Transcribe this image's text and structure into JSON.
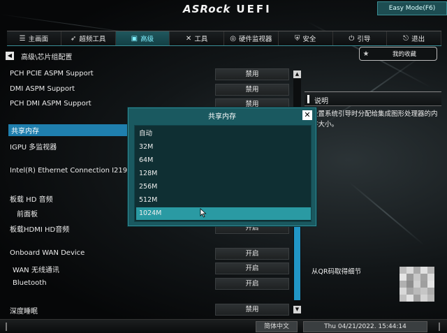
{
  "header": {
    "logo": "ASRock",
    "product": "UEFI",
    "easy_mode_label": "Easy Mode(F6)"
  },
  "tabs": [
    {
      "label": "主画面",
      "icon": "list-icon"
    },
    {
      "label": "超频工具",
      "icon": "rocket-icon"
    },
    {
      "label": "高级",
      "icon": "folder-icon",
      "active": true
    },
    {
      "label": "工具",
      "icon": "tools-icon"
    },
    {
      "label": "硬件监视器",
      "icon": "monitor-icon"
    },
    {
      "label": "安全",
      "icon": "shield-icon"
    },
    {
      "label": "引导",
      "icon": "power-icon"
    },
    {
      "label": "退出",
      "icon": "exit-icon"
    }
  ],
  "breadcrumb": "高级\\芯片组配置",
  "favorites_label": "我的收藏",
  "settings": [
    {
      "label": "PCH PCIE ASPM Support",
      "value": "禁用"
    },
    {
      "label": "DMI ASPM Support",
      "value": "禁用"
    },
    {
      "label": "PCH DMI ASPM Support",
      "value": "禁用"
    },
    {
      "label": "共享内存",
      "value": "",
      "selected": true
    },
    {
      "label": "IGPU 多监视器",
      "value": ""
    },
    {
      "label": "Intel(R) Ethernet Connection I219-V",
      "value": ""
    },
    {
      "label": "板载 HD 音频",
      "value": ""
    },
    {
      "label": "前面板",
      "value": ""
    },
    {
      "label": "板载HDMI HD音频",
      "value": "开启"
    },
    {
      "label": "Onboard WAN Device",
      "value": "开启"
    },
    {
      "label": "WAN 无线通讯",
      "value": "开启"
    },
    {
      "label": "Bluetooth",
      "value": "开启"
    },
    {
      "label": "深度睡眠",
      "value": "禁用"
    }
  ],
  "description": {
    "title": "说明",
    "text": "设置系统引导时分配给集成图形处理器的内存大小。",
    "qr_label": "从QR码取得细节"
  },
  "dialog": {
    "title": "共享内存",
    "options": [
      "自动",
      "32M",
      "64M",
      "128M",
      "256M",
      "512M",
      "1024M"
    ],
    "selected_index": 6
  },
  "footer": {
    "language": "简体中文",
    "datetime": "Thu 04/21/2022. 15:44:14"
  },
  "colors": {
    "accent": "#2a9aa3",
    "selected_row": "#1f7fae",
    "dialog_bg": "#1a5960",
    "scroll_thumb": "#2196c6"
  }
}
